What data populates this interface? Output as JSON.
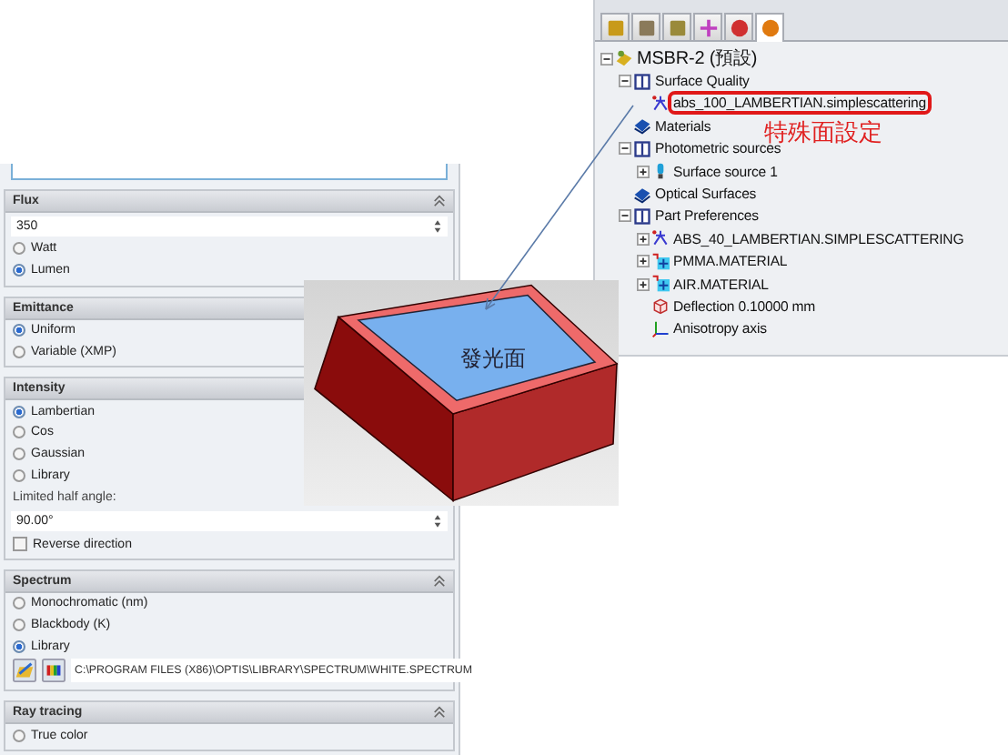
{
  "property_panel": {
    "sections": [
      {
        "title": "Flux",
        "items": [
          {
            "kind": "number_field",
            "value": "350"
          },
          {
            "kind": "radio",
            "label": "Watt",
            "selected": false
          },
          {
            "kind": "radio",
            "label": "Lumen",
            "selected": true
          }
        ]
      },
      {
        "title": "Emittance",
        "items": [
          {
            "kind": "radio",
            "label": "Uniform",
            "selected": true
          },
          {
            "kind": "radio",
            "label": "Variable (XMP)",
            "selected": false
          }
        ]
      },
      {
        "title": "Intensity",
        "items": [
          {
            "kind": "radio",
            "label": "Lambertian",
            "selected": true
          },
          {
            "kind": "radio",
            "label": "Cos",
            "selected": false
          },
          {
            "kind": "radio",
            "label": "Gaussian",
            "selected": false
          },
          {
            "kind": "radio",
            "label": "Library",
            "selected": false
          },
          {
            "kind": "label",
            "text": "Limited half angle:"
          },
          {
            "kind": "number_field",
            "value": "90.00°"
          },
          {
            "kind": "checkbox",
            "label": "Reverse direction",
            "checked": false
          }
        ]
      },
      {
        "title": "Spectrum",
        "items": [
          {
            "kind": "radio",
            "label": "Monochromatic (nm)",
            "selected": false
          },
          {
            "kind": "radio",
            "label": "Blackbody (K)",
            "selected": false
          },
          {
            "kind": "radio",
            "label": "Library",
            "selected": true
          },
          {
            "kind": "file_picker",
            "path": "C:\\PROGRAM FILES (X86)\\OPTIS\\LIBRARY\\SPECTRUM\\WHITE.SPECTRUM"
          }
        ]
      },
      {
        "title": "Ray tracing",
        "items": [
          {
            "kind": "radio",
            "label": "True color",
            "selected": false
          }
        ]
      }
    ]
  },
  "feature_tree": {
    "tabs": [
      {
        "kind": "features",
        "selected": false
      },
      {
        "kind": "properties",
        "selected": false
      },
      {
        "kind": "configurations",
        "selected": false
      },
      {
        "kind": "dimensions",
        "selected": false
      },
      {
        "kind": "display",
        "selected": false
      },
      {
        "kind": "optics",
        "selected": true
      }
    ],
    "nodes": [
      {
        "label": "MSBR-2 (預設)",
        "kind": "part",
        "expanded": true,
        "children": [
          {
            "label": "Surface Quality",
            "kind": "book",
            "expanded": true,
            "children": [
              {
                "label": "abs_100_LAMBERTIAN.simplescattering",
                "kind": "scattering",
                "highlighted": true
              }
            ]
          },
          {
            "label": "Materials",
            "kind": "stack"
          },
          {
            "label": "Photometric sources",
            "kind": "book",
            "expanded": true,
            "children": [
              {
                "label": "Surface source 1",
                "kind": "source",
                "expanded": false
              }
            ]
          },
          {
            "label": "Optical Surfaces",
            "kind": "stack"
          },
          {
            "label": "Part Preferences",
            "kind": "book",
            "expanded": true,
            "children": [
              {
                "label": "ABS_40_LAMBERTIAN.SIMPLESCATTERING",
                "kind": "scattering",
                "expanded": false
              },
              {
                "label": "PMMA.MATERIAL",
                "kind": "material",
                "expanded": false
              },
              {
                "label": "AIR.MATERIAL",
                "kind": "material",
                "expanded": false
              },
              {
                "label": "Deflection 0.10000 mm",
                "kind": "deflection"
              },
              {
                "label": "Anisotropy axis",
                "kind": "axis"
              }
            ]
          }
        ]
      }
    ],
    "annotation": "特殊面設定"
  },
  "model_view": {
    "surface_label": "發光面"
  }
}
